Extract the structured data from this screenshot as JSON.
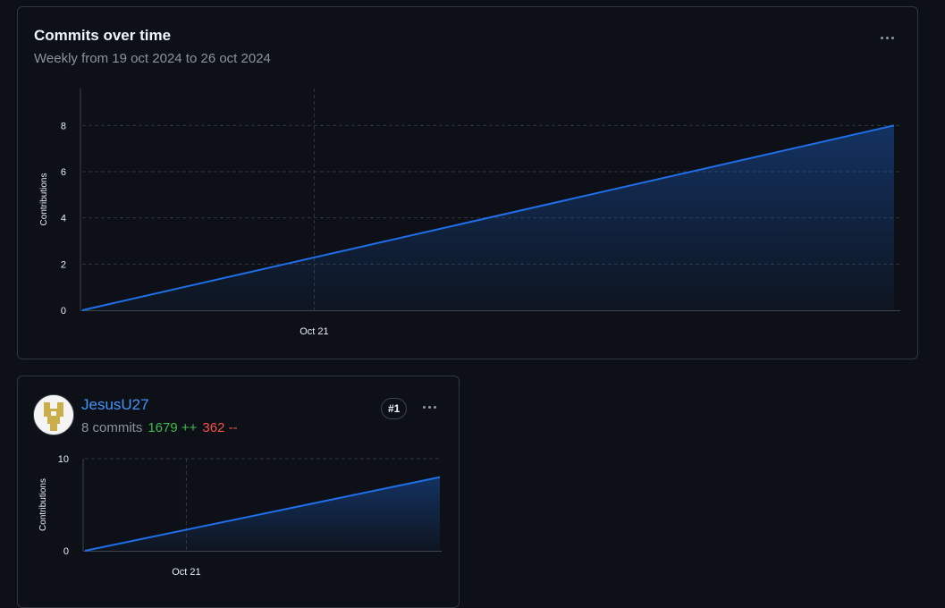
{
  "main_card": {
    "title": "Commits over time",
    "subtitle": "Weekly from 19 oct 2024 to 26 oct 2024"
  },
  "user_card": {
    "username": "JesusU27",
    "commits": "8 commits",
    "additions": "1679 ++",
    "deletions": "362 --",
    "rank": "#1",
    "avatar_colors": {
      "background": "#f4f4f4",
      "pattern": "#c9ae4a"
    }
  },
  "colors": {
    "accent_line": "#1f6feb",
    "additions": "#3fb950",
    "deletions": "#f85149",
    "link": "#4493f8"
  },
  "chart_data": [
    {
      "type": "area",
      "x": [
        "2024-10-19",
        "2024-10-26"
      ],
      "values": [
        0,
        8
      ],
      "ylabel": "Contributions",
      "xlabel": "",
      "x_ticks": [
        "Oct 21"
      ],
      "y_ticks": [
        0,
        2,
        4,
        6,
        8
      ],
      "ylim": [
        0,
        9.6
      ],
      "grid": true
    },
    {
      "type": "area",
      "x": [
        "2024-10-19",
        "2024-10-26"
      ],
      "values": [
        0,
        8
      ],
      "ylabel": "Contributions",
      "xlabel": "",
      "x_ticks": [
        "Oct 21"
      ],
      "y_ticks": [
        0,
        10
      ],
      "ylim": [
        0,
        10
      ],
      "grid": true
    }
  ]
}
